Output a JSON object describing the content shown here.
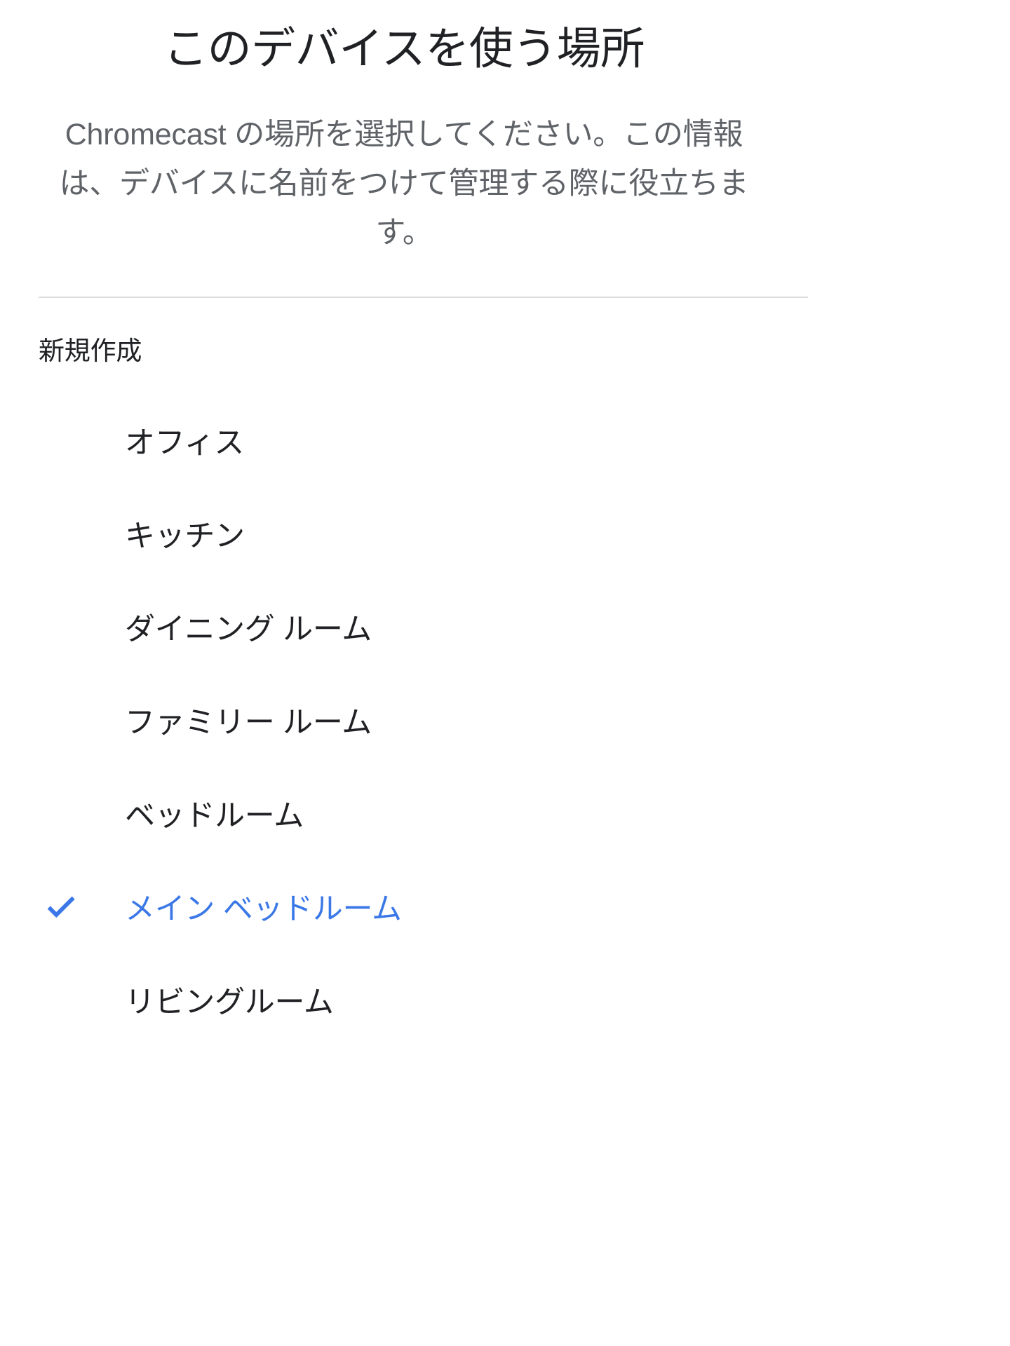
{
  "header": {
    "title": "このデバイスを使う場所",
    "description": "Chromecast の場所を選択してください。この情報は、デバイスに名前をつけて管理する際に役立ちます。"
  },
  "section": {
    "label": "新規作成"
  },
  "rooms": [
    {
      "label": "オフィス",
      "selected": false
    },
    {
      "label": "キッチン",
      "selected": false
    },
    {
      "label": "ダイニング ルーム",
      "selected": false
    },
    {
      "label": "ファミリー ルーム",
      "selected": false
    },
    {
      "label": "ベッドルーム",
      "selected": false
    },
    {
      "label": "メイン ベッドルーム",
      "selected": true
    },
    {
      "label": "リビングルーム",
      "selected": false
    }
  ],
  "icons": {
    "check": "check-icon"
  },
  "colors": {
    "accent": "#3b78e7",
    "title_text": "#202124",
    "body_text": "#5f6368",
    "divider": "#dcdcdc",
    "background": "#ffffff"
  }
}
